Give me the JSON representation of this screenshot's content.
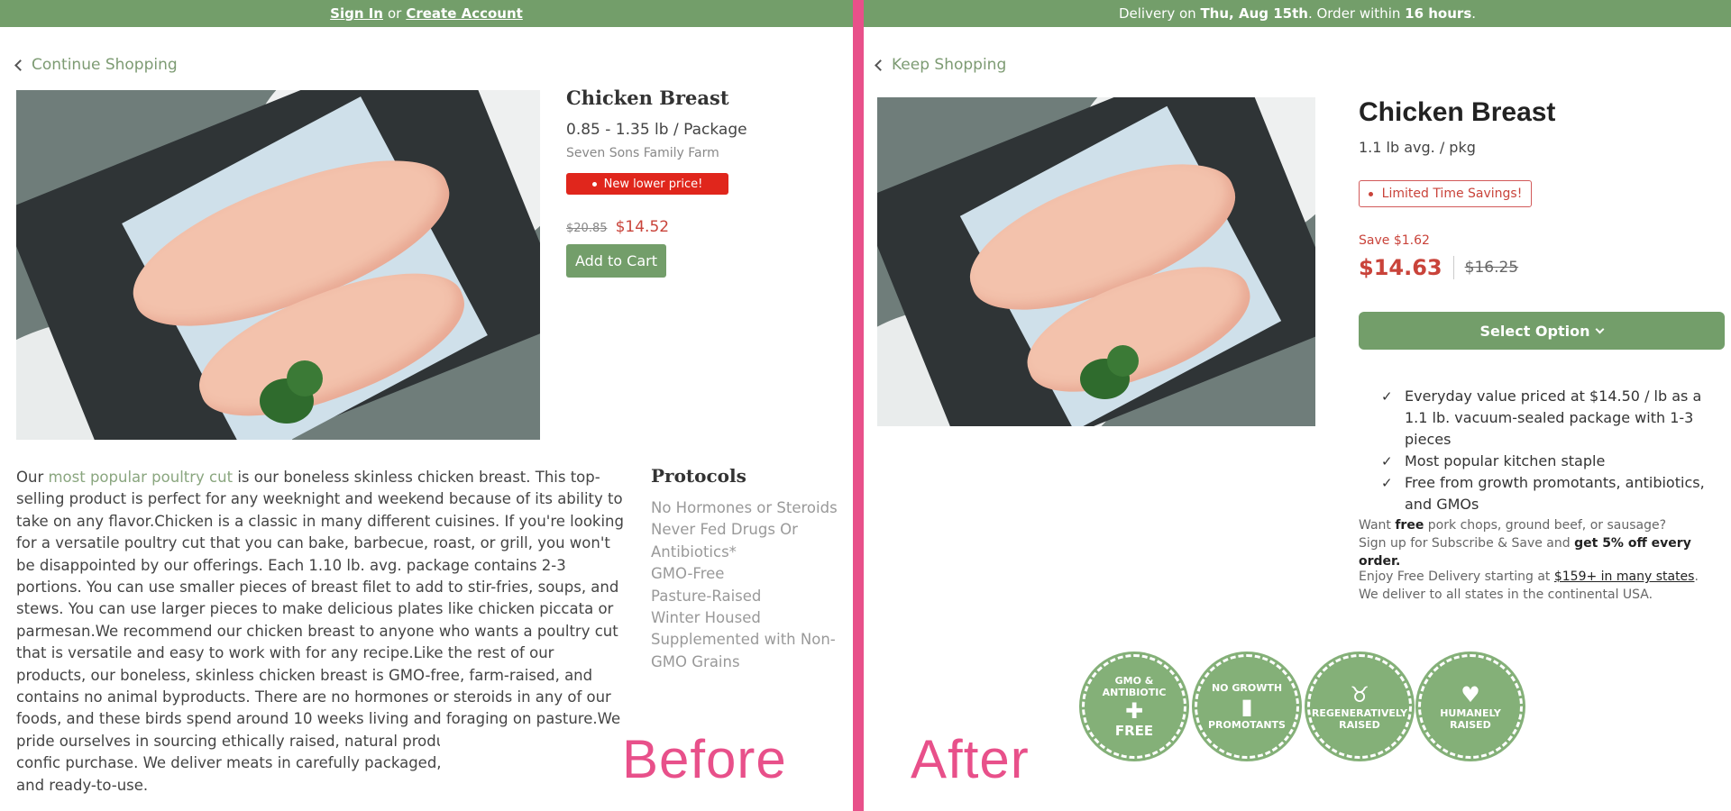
{
  "before": {
    "topbar": {
      "sign_in": "Sign In",
      "or": "or",
      "create_account": "Create Account"
    },
    "back_link": "Continue Shopping",
    "product": {
      "title": "Chicken Breast",
      "size": "0.85 - 1.35 lb / Package",
      "farm": "Seven Sons Family Farm",
      "badge": "New lower price!",
      "old_price": "$20.85",
      "new_price": "$14.52",
      "add_to_cart": "Add to Cart"
    },
    "description": {
      "lead": "Our",
      "link": "most popular poultry cut",
      "body": "is our boneless skinless chicken breast. This top-selling product is perfect for any weeknight and weekend because of its ability to take on any flavor.Chicken is a classic in many different cuisines. If you're looking for a versatile poultry cut that you can bake, barbecue, roast, or grill, you won't be disappointed by our offerings. Each 1.10 lb. avg. package contains 2-3 portions. You can use smaller pieces of breast filet to add to stir-fries, soups, and stews. You can use larger pieces to make delicious plates like chicken piccata or parmesan.We recommend our chicken breast to anyone who wants a poultry cut that is versatile and easy to work with for any recipe.Like the rest of our products, our boneless, skinless chicken breast is GMO-free, farm-raised, and contains no animal byproducts. There are no hormones or steroids in any of our foods, and these birds spend around 10 weeks living and foraging on pasture.We pride ourselves in sourcing ethically raised, natural products so that you can feel confic purchase. We deliver meats in carefully packaged, insulatec products fresh and ready-to-use."
    },
    "protocols": {
      "title": "Protocols",
      "items": [
        "No Hormones or Steroids",
        "Never Fed Drugs Or Antibiotics*",
        "GMO-Free",
        "Pasture-Raised",
        "Winter Housed",
        "Supplemented with Non-GMO Grains"
      ]
    },
    "label": "Before"
  },
  "after": {
    "topbar": {
      "prefix": "Delivery on",
      "date": "Thu, Aug 15th",
      "mid": ". Order within",
      "hours": "16 hours",
      "suffix": "."
    },
    "back_link": "Keep Shopping",
    "product": {
      "title": "Chicken Breast",
      "size": "1.1 lb avg. / pkg",
      "badge": "Limited Time Savings!",
      "save": "Save $1.62",
      "new_price": "$14.63",
      "old_price": "$16.25",
      "select_option": "Select Option"
    },
    "features": [
      "Everyday value priced at $14.50 / lb as a 1.1 lb. vacuum-sealed package with 1-3 pieces",
      "Most popular kitchen staple",
      "Free from growth promotants, antibiotics, and GMOs"
    ],
    "promo": {
      "want": "Want",
      "free": "free",
      "items": "pork chops, ground beef, or sausage?",
      "signup": "Sign up for Subscribe & Save and",
      "offer": "get 5% off every order."
    },
    "delivery": {
      "prefix": "Enjoy Free Delivery starting at",
      "link": "$159+ in many states",
      "suffix": ". We deliver to all states in the continental USA."
    },
    "certifications": [
      {
        "line1": "GMO & ANTIBIOTIC",
        "line2": "FREE",
        "icon": "syringe-icon"
      },
      {
        "line1": "NO GROWTH",
        "line2": "PROMOTANTS",
        "icon": "bottle-icon"
      },
      {
        "line1": "REGENERATIVELY",
        "line2": "RAISED",
        "icon": "cow-icon"
      },
      {
        "line1": "HUMANELY",
        "line2": "RAISED",
        "icon": "heart-hands-icon"
      }
    ],
    "label": "After"
  },
  "colors": {
    "brand_green": "#739e6a",
    "accent_pink": "#e8508a",
    "price_red": "#c9433a",
    "badge_red": "#e0261c"
  }
}
